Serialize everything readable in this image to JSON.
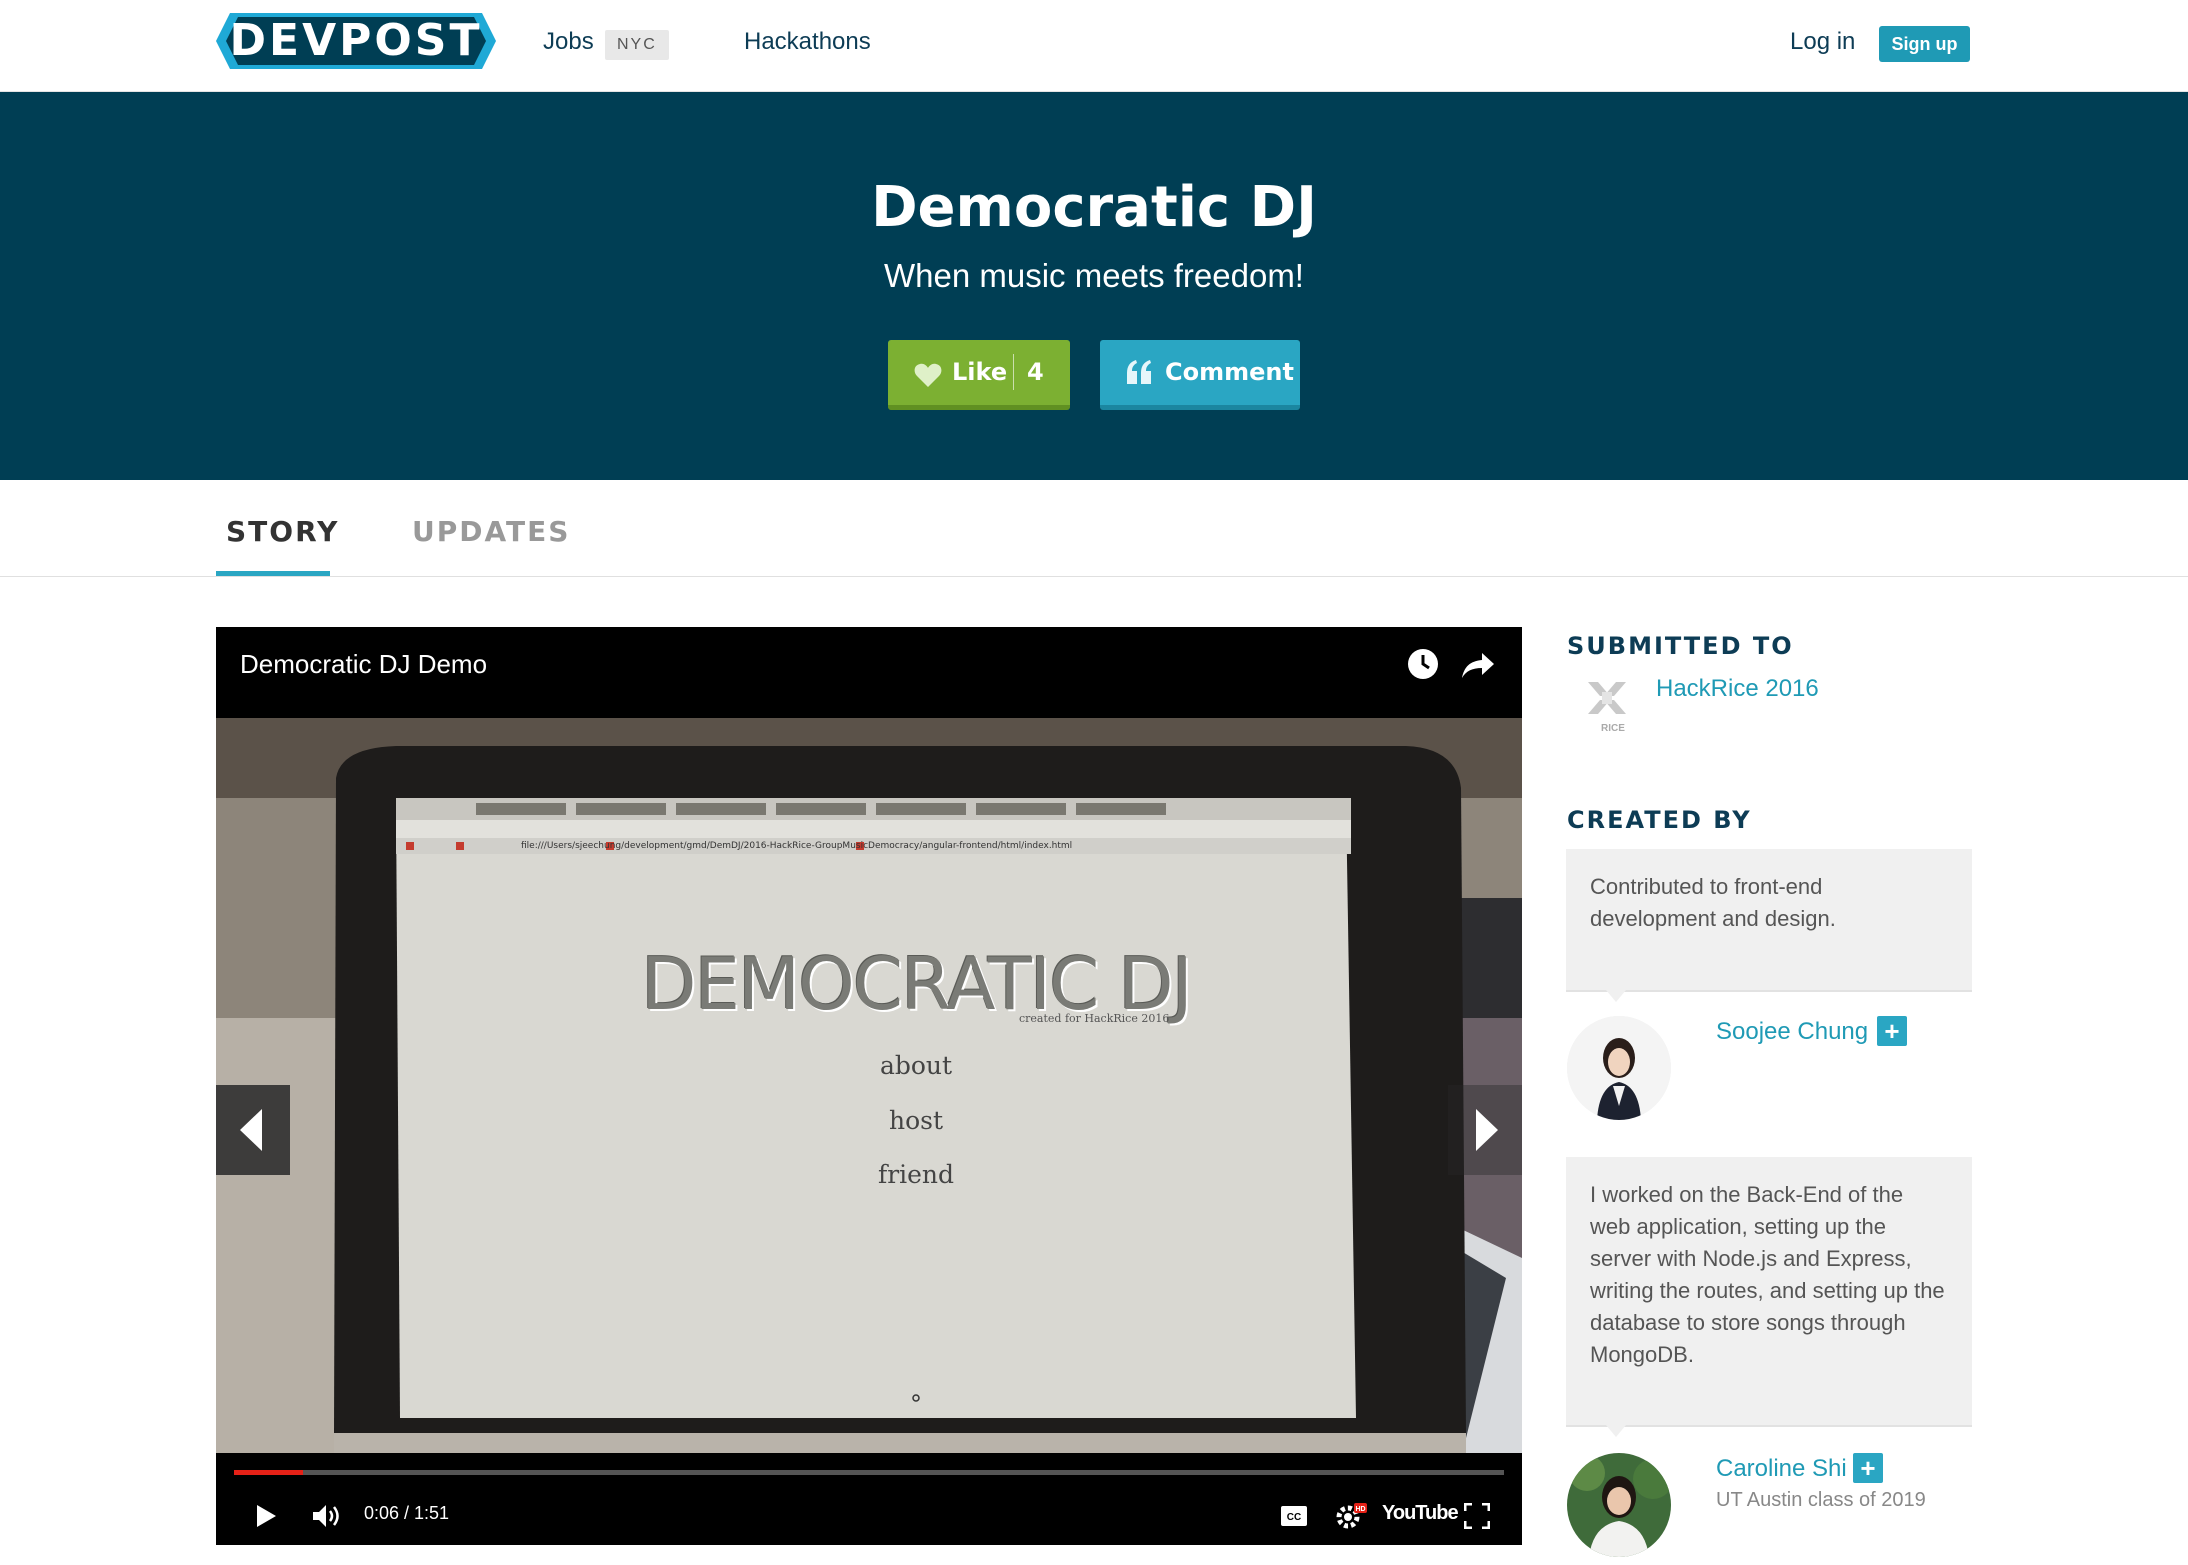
{
  "nav": {
    "logo": "DEVPOST",
    "jobs": "Jobs",
    "jobs_badge": "NYC",
    "hackathons": "Hackathons",
    "login": "Log in",
    "signup": "Sign up"
  },
  "hero": {
    "title": "Democratic DJ",
    "tagline": "When music meets freedom!",
    "like_label": "Like",
    "like_count": "4",
    "comment_label": "Comment"
  },
  "tabs": {
    "story": "STORY",
    "updates": "UPDATES"
  },
  "video": {
    "title": "Democratic DJ Demo",
    "time": "0:06 / 1:51",
    "progress_fraction": 0.054,
    "youtube_label": "YouTube",
    "screen": {
      "title": "DEMOCRATIC DJ",
      "subtitle": "created for HackRice 2016",
      "menu": [
        "about",
        "host",
        "friend"
      ],
      "url": "file:///Users/sjeechung/development/gmd/DemDJ/2016-HackRice-GroupMusicDemocracy/angular-frontend/html/index.html"
    }
  },
  "sidebar": {
    "submitted_heading": "SUBMITTED TO",
    "hackathon": "HackRice 2016",
    "hackathon_logo_text": "RICE",
    "created_heading": "CREATED BY",
    "members": [
      {
        "contribution": "Contributed to front-end development and design.",
        "name": "Soojee Chung",
        "subtitle": ""
      },
      {
        "contribution": "I worked on the Back-End of the web application, setting up the server with Node.js and Express, writing the routes, and setting up the database to store songs through MongoDB.",
        "name": "Caroline Shi",
        "subtitle": "UT Austin class of 2019"
      }
    ]
  },
  "colors": {
    "brand_dark": "#003e54",
    "accent": "#2aa6c3",
    "like_green": "#7cb032",
    "progress_red": "#e52117"
  }
}
